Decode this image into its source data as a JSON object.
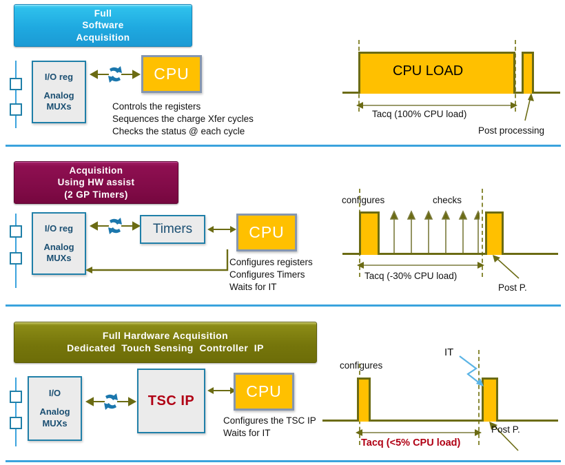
{
  "meta": {
    "colors": {
      "blue_banner": "#1fa9e0",
      "purple_banner": "#820b48",
      "olive_banner": "#76760b",
      "cpu_fill": "#ffc000",
      "block_border": "#1f7fa8",
      "block_fill": "#ebebeb",
      "waveform": "#6b6b13",
      "divider": "#3aa3dd",
      "tsc_text": "#b00014"
    }
  },
  "sections": [
    {
      "id": "full-software",
      "banner": {
        "lines": [
          "Full",
          "Software",
          "Acquisition"
        ]
      },
      "io_block": {
        "line1": "I/O reg",
        "line2": "Analog\nMUXs"
      },
      "sync_icon": "sync-arrows-icon",
      "cpu_label": "CPU",
      "description": "Controls the registers\nSequences the charge Xfer cycles\nChecks the status @ each cycle",
      "timing": {
        "pulse_label": "CPU LOAD",
        "measure_label": "Tacq (100% CPU load)",
        "post_label": "Post processing"
      }
    },
    {
      "id": "hw-assist",
      "banner": {
        "lines": [
          "Acquisition",
          "Using HW assist",
          "(2 GP Timers)"
        ]
      },
      "io_block": {
        "line1": "I/O reg",
        "line2": "Analog\nMUXs"
      },
      "sync_icon": "sync-arrows-icon",
      "timers_label": "Timers",
      "cpu_label": "CPU",
      "description": "Configures registers\nConfigures Timers\nWaits for IT",
      "timing": {
        "configures_label": "configures",
        "checks_label": "checks",
        "check_arrow_count": 6,
        "measure_label": "Tacq (-30% CPU load)",
        "post_label": "Post P."
      }
    },
    {
      "id": "full-hardware",
      "banner": {
        "lines": [
          "Full Hardware Acquisition",
          "Dedicated  Touch Sensing  Controller  IP"
        ]
      },
      "io_block": {
        "line1": "I/O",
        "line2": "Analog\nMUXs"
      },
      "sync_icon": "sync-arrows-icon",
      "tsc_label": "TSC IP",
      "cpu_label": "CPU",
      "description": "Configures the TSC IP\nWaits for IT",
      "timing": {
        "configures_label": "configures",
        "it_label": "IT",
        "measure_label": "Tacq (<5% CPU load)",
        "post_label": "Post P."
      }
    }
  ]
}
